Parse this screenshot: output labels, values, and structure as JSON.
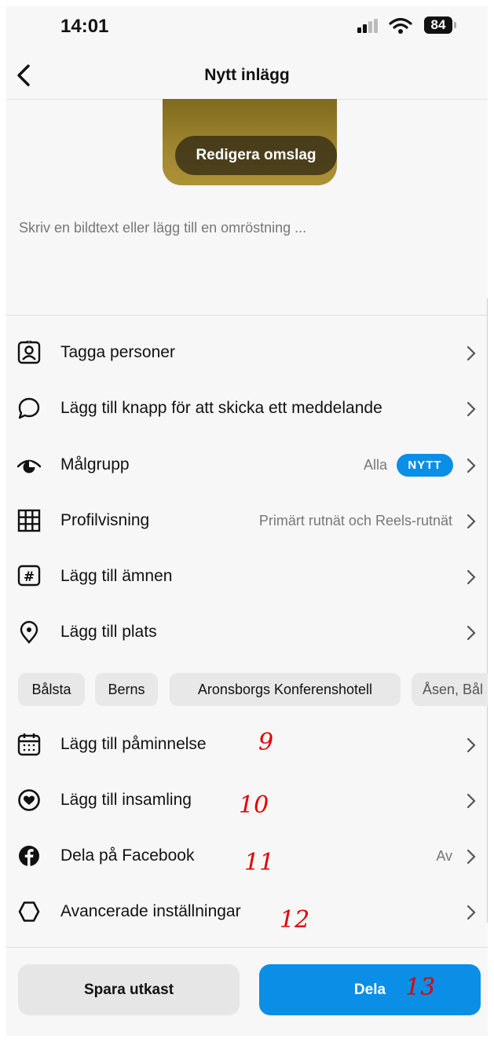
{
  "status_bar": {
    "time": "14:01",
    "battery": "84"
  },
  "nav": {
    "title": "Nytt inlägg"
  },
  "cover": {
    "edit_label": "Redigera omslag"
  },
  "caption": {
    "placeholder": "Skriv en bildtext eller lägg till en omröstning ..."
  },
  "menu": {
    "tag_people": {
      "label": "Tagga personer",
      "icon": "tag-person-icon"
    },
    "message_button": {
      "label": "Lägg till knapp för att skicka ett meddelande",
      "icon": "message-bubble-icon"
    },
    "audience": {
      "label": "Målgrupp",
      "value": "Alla",
      "badge": "NYTT",
      "icon": "audience-eye-icon"
    },
    "profile_view": {
      "label": "Profilvisning",
      "value": "Primärt rutnät och Reels-rutnät",
      "icon": "grid-icon"
    },
    "topics": {
      "label": "Lägg till ämnen",
      "icon": "hashtag-icon"
    },
    "location": {
      "label": "Lägg till plats",
      "icon": "location-pin-icon"
    },
    "reminder": {
      "label": "Lägg till påminnelse",
      "icon": "calendar-icon"
    },
    "fundraiser": {
      "label": "Lägg till insamling",
      "icon": "fundraiser-heart-icon"
    },
    "facebook": {
      "label": "Dela på Facebook",
      "value": "Av",
      "icon": "facebook-icon"
    },
    "advanced": {
      "label": "Avancerade inställningar",
      "icon": "settings-gear-icon"
    }
  },
  "location_chips": [
    "Bålsta",
    "Berns",
    "Aronsborgs Konferenshotell",
    "Åsen, Bål"
  ],
  "annotations": [
    "9",
    "10",
    "11",
    "12",
    "13"
  ],
  "buttons": {
    "save": "Spara utkast",
    "share": "Dela"
  },
  "colors": {
    "accent": "#0a8ee6",
    "annotation": "#e10000",
    "cover": "#9e8530"
  }
}
